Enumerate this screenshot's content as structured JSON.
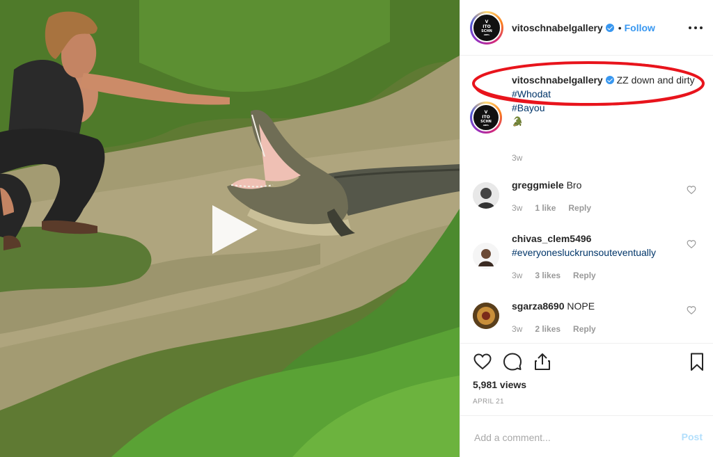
{
  "post": {
    "username": "vitoschnabelgallery",
    "follow_label": "Follow",
    "separator": "•",
    "avatar_logo_line1": "V",
    "avatar_logo_line2": "ITO",
    "avatar_logo_line3": "SCHN",
    "avatar_logo_line4": "ABEL"
  },
  "caption": {
    "username": "vitoschnabelgallery",
    "text": "ZZ down and dirty",
    "hashtags": [
      "#Whodat",
      "#Bayou"
    ],
    "emoji": "🐊",
    "age": "3w"
  },
  "comments": [
    {
      "username": "greggmiele",
      "text": "Bro",
      "age": "3w",
      "likes": "1 like",
      "reply": "Reply"
    },
    {
      "username": "chivas_clem5496",
      "text": "#everyonesluckrunsouteventually",
      "age": "3w",
      "likes": "3 likes",
      "reply": "Reply"
    },
    {
      "username": "sgarza8690",
      "text": "NOPE",
      "age": "3w",
      "likes": "2 likes",
      "reply": "Reply"
    }
  ],
  "stats": {
    "views": "5,981 views",
    "date": "APRIL 21"
  },
  "add_comment": {
    "placeholder": "Add a comment...",
    "post_label": "Post"
  },
  "icons": {
    "like": "heart-icon",
    "comment": "comment-icon",
    "share": "share-icon",
    "save": "bookmark-icon",
    "more": "more-icon",
    "play": "play-icon"
  },
  "colors": {
    "link": "#3897f0",
    "hashtag": "#003569",
    "muted": "#999999",
    "annotation": "#e8141c"
  }
}
